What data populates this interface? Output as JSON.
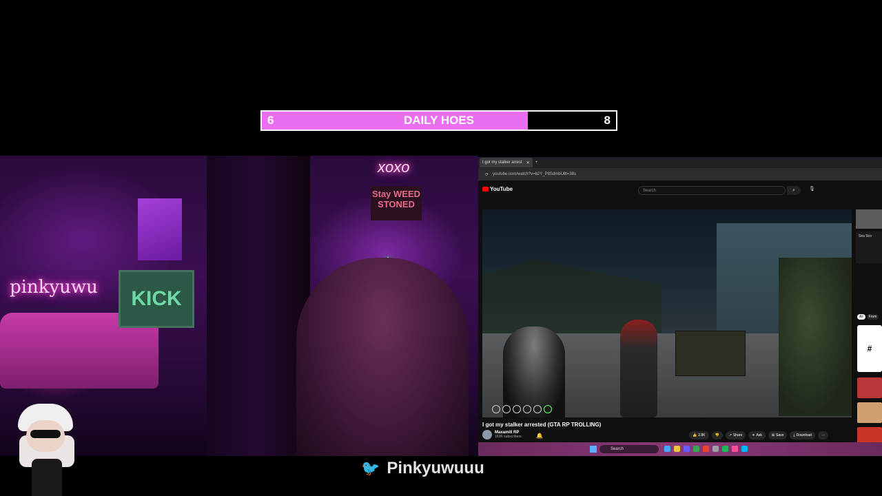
{
  "goal": {
    "current": "6",
    "title": "DAILY HOES",
    "max": "8",
    "progress_fraction": 0.75,
    "fill_color": "#ea6ef0"
  },
  "webcam": {
    "signs": {
      "pinky": "pinkyuwu",
      "kick": "KICK",
      "xoxo": "xoxo",
      "stoned": "Stay WEED STONED"
    }
  },
  "browser": {
    "tab_title": "I got my stalker arrest",
    "address": "youtube.com/watch?v=b2Y_P8SdmbU8t=38s",
    "yt": {
      "logo": "YouTube",
      "search_placeholder": "Search",
      "video_title": "I got my stalker arrested (GTA RP TROLLING)",
      "channel_name": "Maxamill RP",
      "subscribers": "163K subscribers",
      "actions": [
        {
          "icon": "like-icon",
          "label": "2.8K"
        },
        {
          "icon": "dislike-icon",
          "label": ""
        },
        {
          "icon": "share-icon",
          "label": "Share"
        },
        {
          "icon": "ask-icon",
          "label": "Ask"
        },
        {
          "icon": "save-icon",
          "label": "Save"
        },
        {
          "icon": "download-icon",
          "label": "Download"
        },
        {
          "icon": "more-icon",
          "label": "···"
        }
      ],
      "sidebar": {
        "card_text": "Sea Sco",
        "chip_all": "All",
        "chip_from": "From"
      }
    },
    "taskbar": {
      "search_label": "Search"
    }
  },
  "twitter": {
    "handle": "Pinkyuwuuu",
    "icon": "twitter-icon",
    "color": "#1d9bf0"
  }
}
